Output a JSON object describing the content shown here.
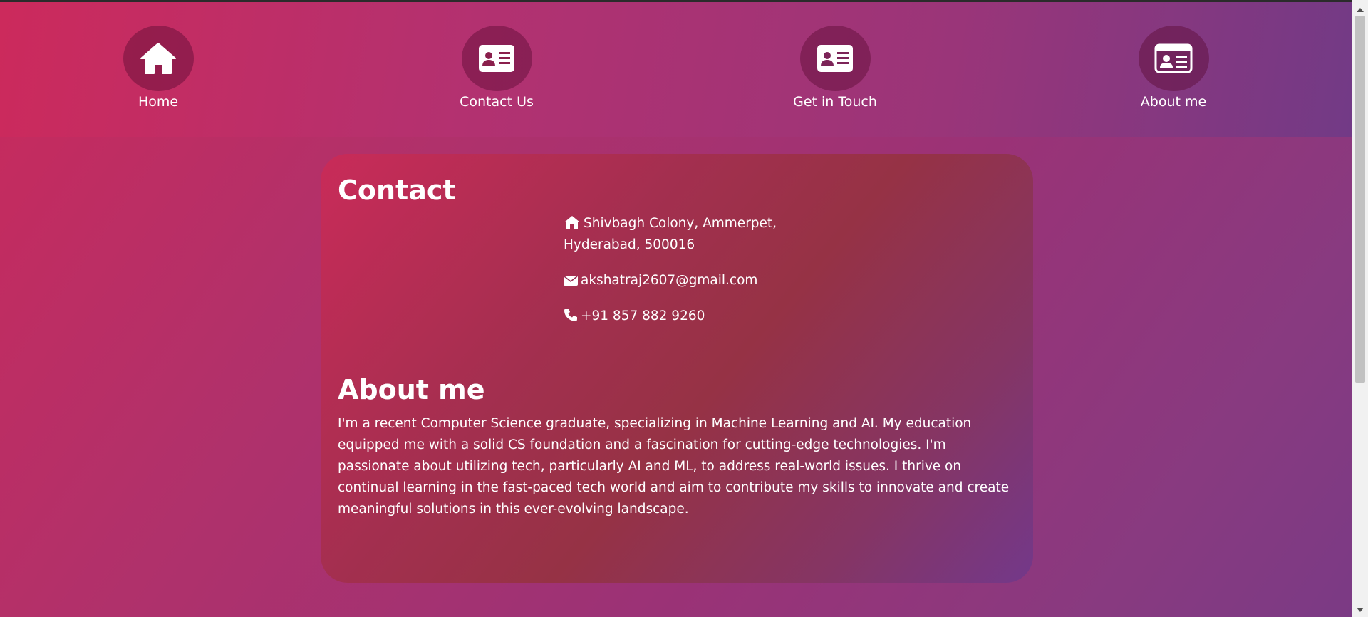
{
  "nav": {
    "items": [
      {
        "label": "Home",
        "icon": "home-icon"
      },
      {
        "label": "Contact Us",
        "icon": "id-card-icon"
      },
      {
        "label": "Get in Touch",
        "icon": "id-card-icon"
      },
      {
        "label": "About me",
        "icon": "id-card-outline-icon"
      }
    ]
  },
  "contact": {
    "heading": "Contact",
    "address_line1": "Shivbagh Colony, Ammerpet,",
    "address_line2": "Hyderabad, 500016",
    "email": "akshatraj2607@gmail.com",
    "phone": "+91 857 882 9260"
  },
  "about": {
    "heading": "About me",
    "text": "I'm a recent Computer Science graduate, specializing in Machine Learning and AI. My education equipped me with a solid CS foundation and a fascination for cutting-edge technologies. I'm passionate about utilizing tech, particularly AI and ML, to address real-world issues. I thrive on continual learning in the fast-paced tech world and aim to contribute my skills to innovate and create meaningful solutions in this ever-evolving landscape."
  },
  "colors": {
    "gradient_start": "#c92a5c",
    "gradient_end": "#7a3a85",
    "text": "#ffffff"
  }
}
